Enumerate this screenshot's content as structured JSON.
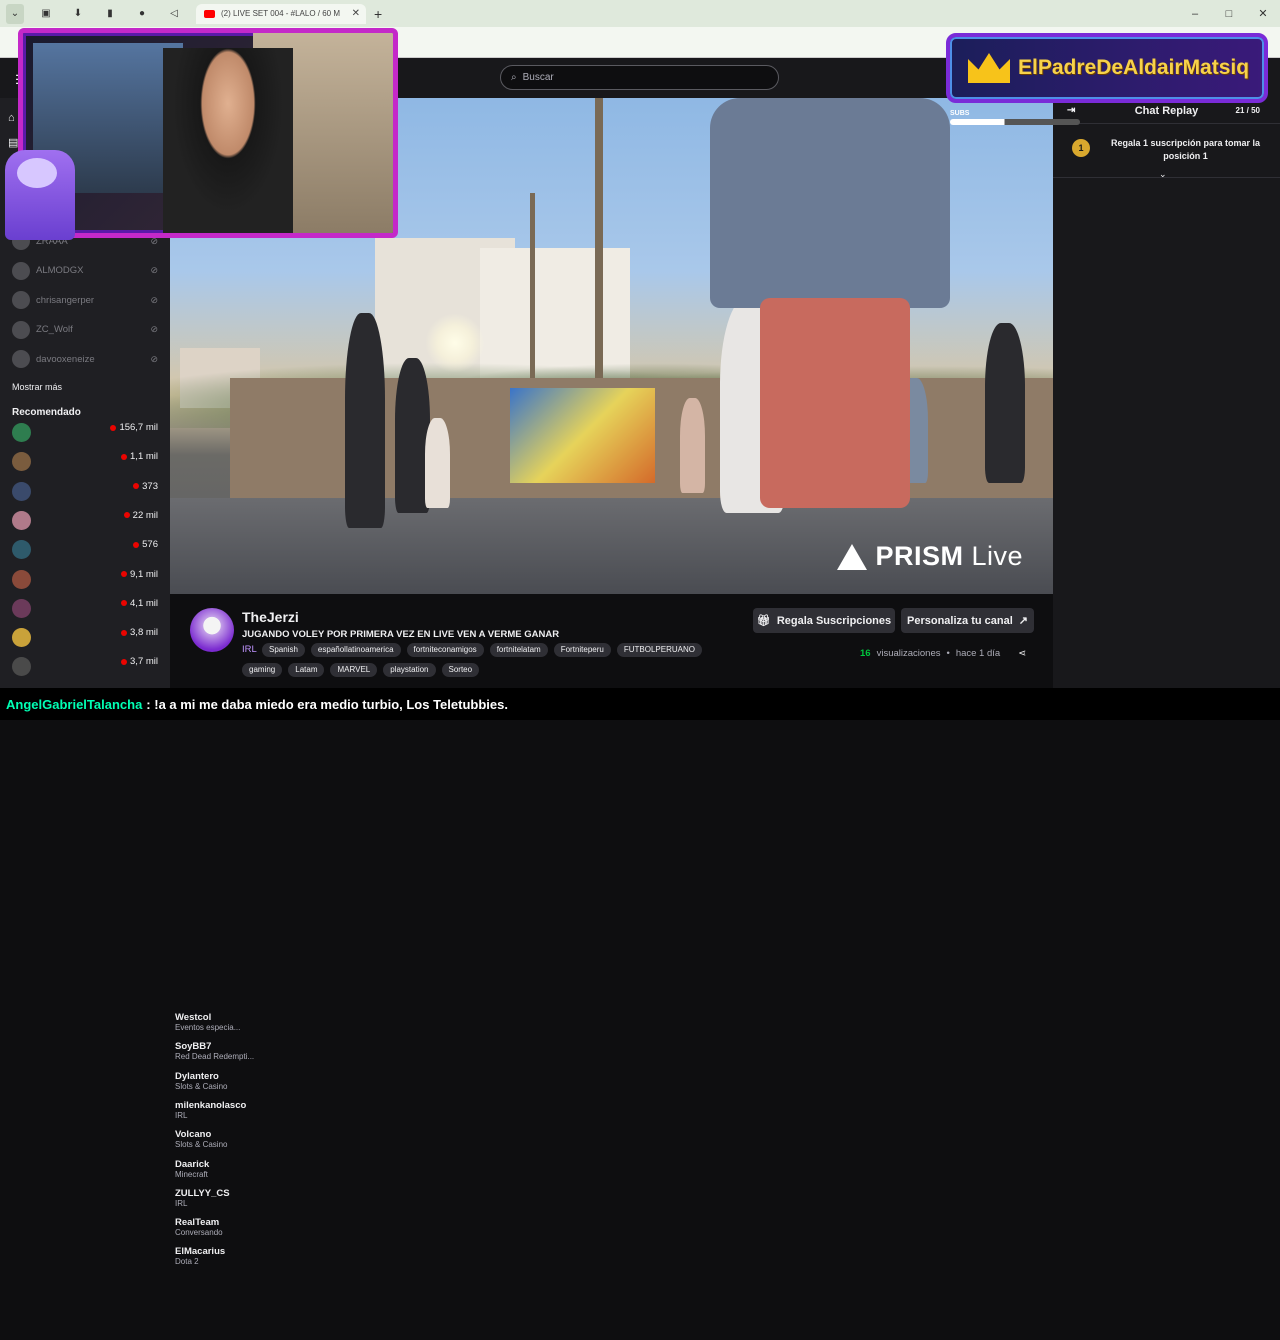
{
  "browser": {
    "active_tab_title": "(2) LIVE SET 004 - #LALO / 60 M",
    "new_tab": "+",
    "win_min": "–",
    "win_max": "□",
    "win_close": "✕"
  },
  "search": {
    "placeholder": "Buscar"
  },
  "sidebar": {
    "followed": [
      {
        "name": "ZRAAA"
      },
      {
        "name": "ALMODGX"
      },
      {
        "name": "chrisangerper"
      },
      {
        "name": "ZC_Wolf"
      },
      {
        "name": "davooxeneize"
      }
    ],
    "more": "Mostrar más",
    "recommended_title": "Recomendado",
    "recommended": [
      {
        "name": "Westcol",
        "category": "Eventos especia...",
        "viewers": "156,7 mil",
        "color": "#2e7d4f"
      },
      {
        "name": "SoyBB7",
        "category": "Red Dead Redempti...",
        "viewers": "1,1 mil",
        "color": "#7a5c3e"
      },
      {
        "name": "Dylantero",
        "category": "Slots & Casino",
        "viewers": "373",
        "color": "#3a4a6b"
      },
      {
        "name": "milenkanolasco",
        "category": "IRL",
        "viewers": "22 mil",
        "color": "#b07a8a"
      },
      {
        "name": "Volcano",
        "category": "Slots & Casino",
        "viewers": "576",
        "color": "#2e5a6b"
      },
      {
        "name": "Daarick",
        "category": "Minecraft",
        "viewers": "9,1 mil",
        "color": "#8a4a3a"
      },
      {
        "name": "ZULLYY_CS",
        "category": "IRL",
        "viewers": "4,1 mil",
        "color": "#6b3a5a"
      },
      {
        "name": "RealTeam",
        "category": "Conversando",
        "viewers": "3,8 mil",
        "color": "#c9a23a"
      },
      {
        "name": "ElMacarius",
        "category": "Dota 2",
        "viewers": "3,7 mil",
        "color": "#4a4a4a"
      }
    ]
  },
  "video": {
    "watermark_brand": "PRISM",
    "watermark_word": "Live"
  },
  "channel": {
    "name": "TheJerzi",
    "title": "JUGANDO VOLEY POR PRIMERA VEZ EN LIVE VEN A VERME GANAR",
    "category": "IRL",
    "tags_row1": [
      "Spanish",
      "españollatinoamerica",
      "fortniteconamigos",
      "fortnitelatam",
      "Fortniteperu",
      "FUTBOLPERUANO"
    ],
    "tags_row2": [
      "gaming",
      "Latam",
      "MARVEL",
      "playstation",
      "Sorteo"
    ],
    "gift_button": "Regala Suscripciones",
    "custom_button": "Personaliza tu canal",
    "views_count": "16",
    "views_label": "visualizaciones",
    "time_ago": "hace 1 día"
  },
  "chat": {
    "title": "Chat Replay",
    "count": "21",
    "count_total": "/ 50",
    "gift_text": "Regala 1 suscripción para tomar la posición 1",
    "rank": "1"
  },
  "overlay": {
    "subs_label": "SUBS",
    "subs_progress": 0.42,
    "badge_name": "ElPadreDeAldairMatsiq"
  },
  "ticker": {
    "user": "AngelGabrielTalancha",
    "message": ": !a a mi me daba miedo era medio turbio, Los Teletubbies."
  }
}
